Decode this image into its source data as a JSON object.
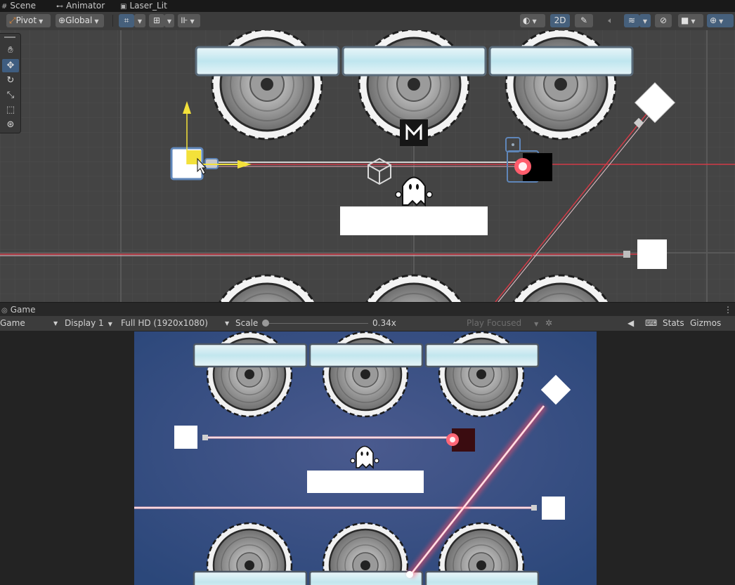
{
  "tabs": [
    {
      "label": "Scene",
      "icon": "grid-icon"
    },
    {
      "label": "Animator",
      "icon": "animator-icon"
    },
    {
      "label": "Laser_Lit",
      "icon": "lock-icon"
    }
  ],
  "scene_toolbar": {
    "pivot_label": "Pivot",
    "global_label": "Global",
    "mode_2d_label": "2D"
  },
  "tools": [
    "hand-tool",
    "move-tool",
    "rotate-tool",
    "scale-tool",
    "rect-tool",
    "transform-tool"
  ],
  "game_panel": {
    "tab_label": "Game",
    "view_select": "Game",
    "display_select": "Display 1",
    "resolution_select": "Full HD (1920x1080)",
    "scale_label": "Scale",
    "scale_value": "0.34x",
    "play_focused": "Play Focused",
    "stats_label": "Stats",
    "gizmos_label": "Gizmos"
  },
  "colors": {
    "scene_bg": "#444444",
    "game_bg": "#2f4d7e",
    "laser": "#ff5060",
    "selection": "#5f86b9",
    "gizmo_yellow": "#f3e13a"
  }
}
